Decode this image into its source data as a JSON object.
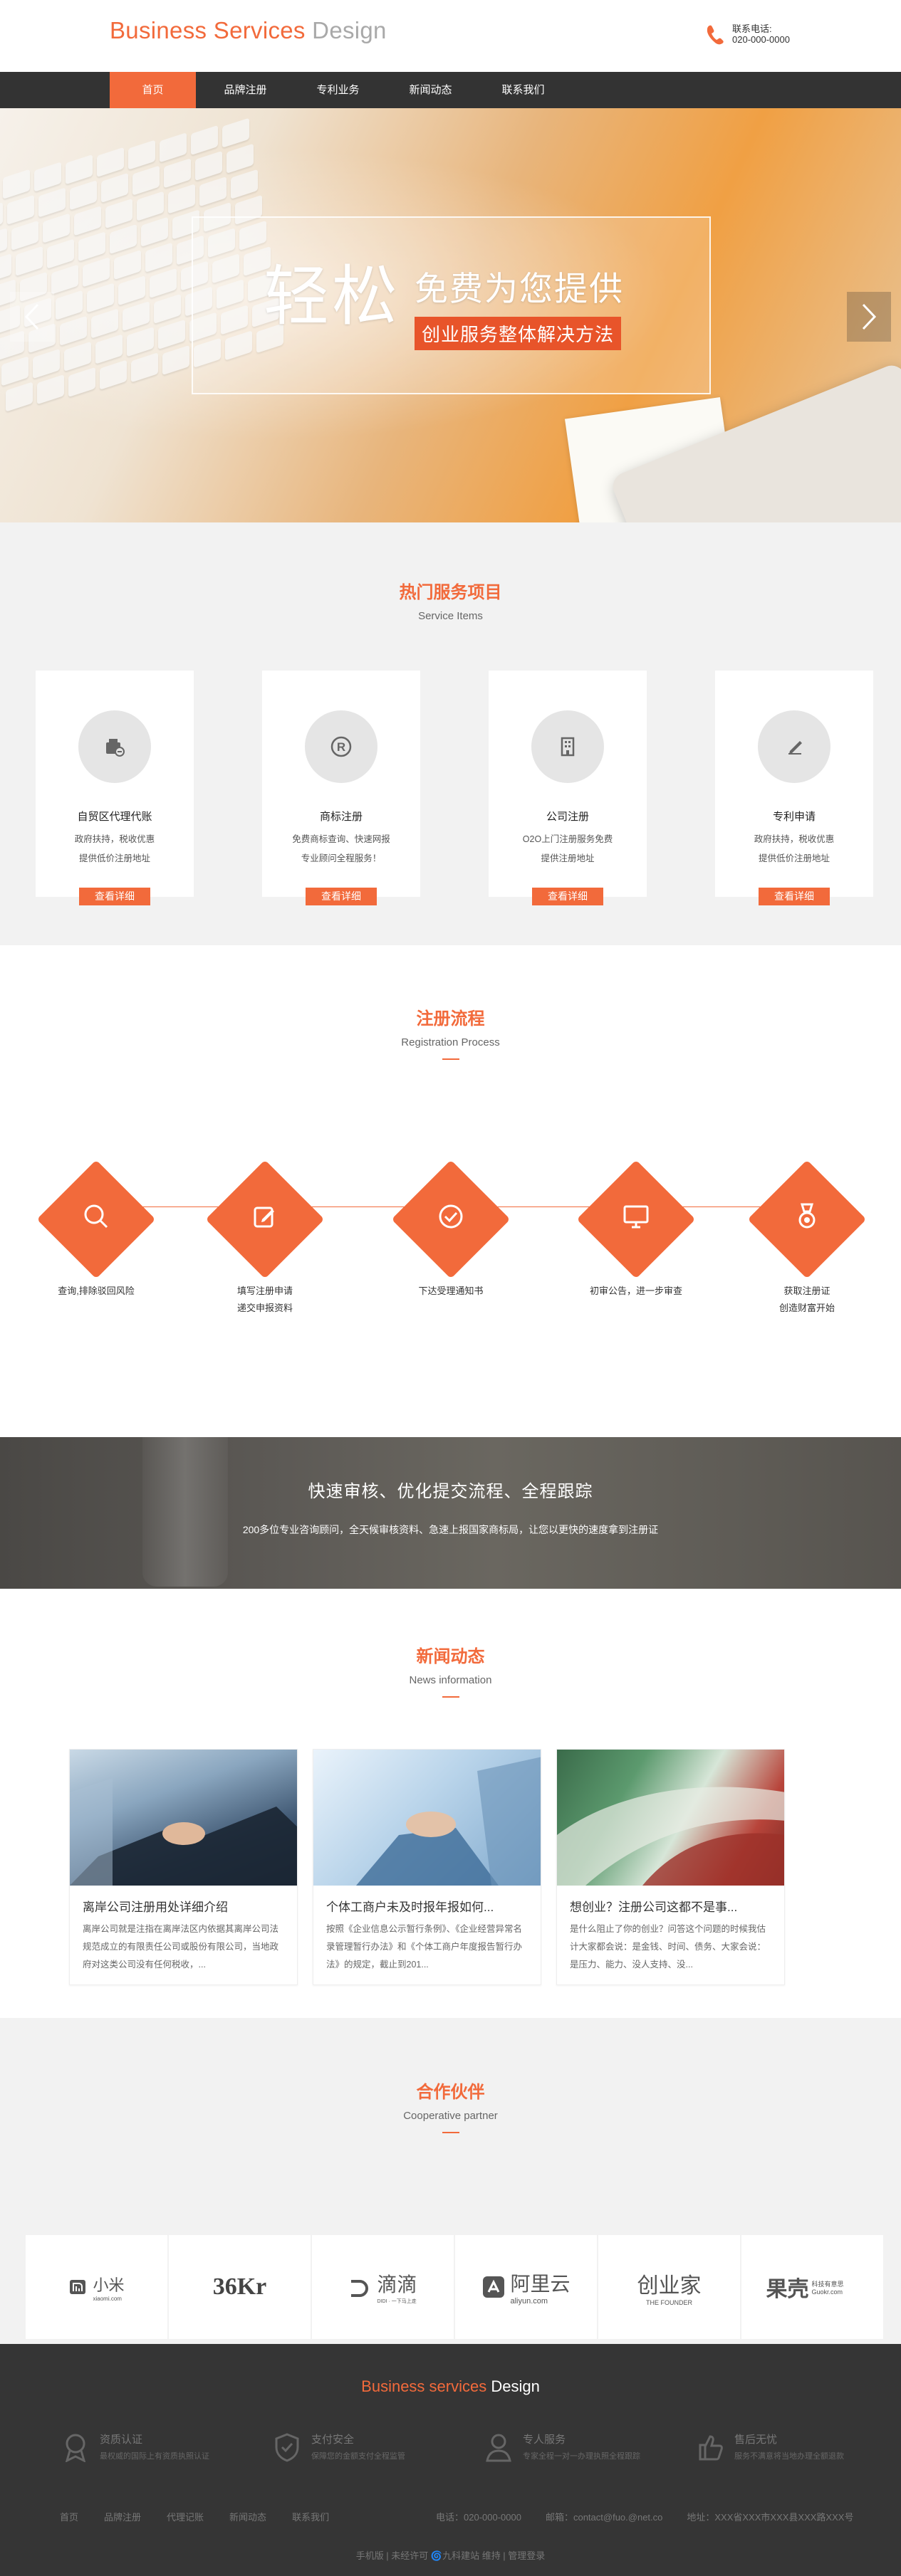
{
  "header": {
    "logo_part1": "Business Services",
    "logo_part2": " Design",
    "phone_label": "联系电话:",
    "phone_number": "020-000-0000"
  },
  "nav": {
    "items": [
      {
        "label": "首页",
        "active": true
      },
      {
        "label": "品牌注册",
        "active": false
      },
      {
        "label": "专利业务",
        "active": false
      },
      {
        "label": "新闻动态",
        "active": false
      },
      {
        "label": "联系我们",
        "active": false
      }
    ]
  },
  "banner": {
    "big_text": "轻松",
    "mid_text": "免费为您提供",
    "tag_text": "创业服务整体解决方法"
  },
  "services": {
    "title": "热门服务项目",
    "subtitle": "Service Items",
    "cards": [
      {
        "name": "自贸区代理代账",
        "desc1": "政府扶持，税收优惠",
        "desc2": "提供低价注册地址",
        "button": "查看详细",
        "icon": "car-register-icon"
      },
      {
        "name": "商标注册",
        "desc1": "免费商标查询、快速网报",
        "desc2": "专业顾问全程服务！",
        "button": "查看详细",
        "icon": "registered-trademark-icon"
      },
      {
        "name": "公司注册",
        "desc1": "O2O上门注册服务免费",
        "desc2": "提供注册地址",
        "button": "查看详细",
        "icon": "building-icon"
      },
      {
        "name": "专利申请",
        "desc1": "政府扶持，税收优惠",
        "desc2": "提供低价注册地址",
        "button": "查看详细",
        "icon": "pen-document-icon"
      }
    ]
  },
  "process": {
    "title": "注册流程",
    "subtitle": "Registration Process",
    "steps": [
      {
        "line1": "查询,排除驳回风险",
        "line2": "",
        "icon": "search-icon"
      },
      {
        "line1": "填写注册申请",
        "line2": "递交申报资料",
        "icon": "edit-icon"
      },
      {
        "line1": "下达受理通知书",
        "line2": "",
        "icon": "check-circle-icon"
      },
      {
        "line1": "初审公告，进一步审查",
        "line2": "",
        "icon": "monitor-icon"
      },
      {
        "line1": "获取注册证",
        "line2": "创造财富开始",
        "icon": "medal-icon"
      }
    ]
  },
  "callout": {
    "title": "快速审核、优化提交流程、全程跟踪",
    "text": "200多位专业咨询顾问，全天候审核资料、急速上报国家商标局，让您以更快的速度拿到注册证"
  },
  "news": {
    "title": "新闻动态",
    "subtitle": "News information",
    "items": [
      {
        "title": "离岸公司注册用处详细介绍",
        "body": "离岸公司就是注指在离岸法区内依据其离岸公司法规范成立的有限责任公司或股份有限公司，当地政府对这类公司没有任何税收，..."
      },
      {
        "title": "个体工商户未及时报年报如何...",
        "body": "按照《企业信息公示暂行条例》、《企业经营异常名录管理暂行办法》和《个体工商户年度报告暂行办法》的规定，截止到201..."
      },
      {
        "title": "想创业？注册公司这都不是事...",
        "body": "是什么阻止了你的创业？问答这个问题的时候我估计大家都会说：是金钱、时间、债务、大家会说：是压力、能力、没人支持、没..."
      }
    ]
  },
  "partners": {
    "title": "合作伙伴",
    "subtitle": "Cooperative partner",
    "items": [
      {
        "name": "小米",
        "sub": "xiaomi.com"
      },
      {
        "name": "36Kr",
        "sub": ""
      },
      {
        "name": "滴滴",
        "sub": "DIDI · 一下马上走"
      },
      {
        "name": "阿里云",
        "sub": "aliyun.com"
      },
      {
        "name": "创业家",
        "sub": "THE FOUNDER"
      },
      {
        "name": "果壳",
        "sub": "科技有意思 Guokr.com"
      }
    ]
  },
  "footer": {
    "logo_part1": "Business services",
    "logo_part2": " Design",
    "features": [
      {
        "title": "资质认证",
        "desc": "最权威的国际上有资质执照认证",
        "icon": "award-icon"
      },
      {
        "title": "支付安全",
        "desc": "保障您的金额支付全程监管",
        "icon": "shield-check-icon"
      },
      {
        "title": "专人服务",
        "desc": "专家全程一对一办理执照全程跟踪",
        "icon": "user-icon"
      },
      {
        "title": "售后无忧",
        "desc": "服务不满意将当地办理全额退款",
        "icon": "thumbs-up-icon"
      }
    ],
    "links": [
      "首页",
      "品牌注册",
      "代理记账",
      "新闻动态",
      "联系我们"
    ],
    "phone": "电话：020-000-0000",
    "email": "邮箱：contact@fuo.@net.co",
    "address": "地址：XXX省XXX市XXX县XXX路XXX号",
    "bottom": "手机版 | 未经许可 🌀九科建站 维持 | 管理登录"
  },
  "colors": {
    "accent": "#f26a3b",
    "nav_bg": "#333333",
    "footer_bg": "#353535",
    "section_gray": "#f2f2f2"
  }
}
